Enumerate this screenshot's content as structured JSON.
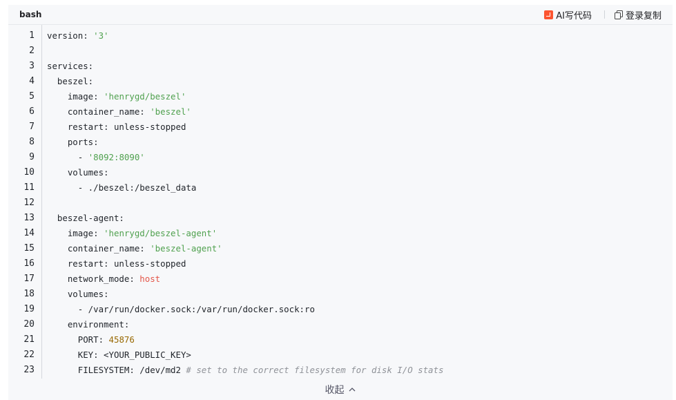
{
  "header": {
    "language": "bash",
    "ai_label": "AI写代码",
    "copy_label": "登录复制"
  },
  "footer": {
    "collapse_label": "收起"
  },
  "lines": [
    [
      {
        "t": "version: ",
        "c": ""
      },
      {
        "t": "'3'",
        "c": "string"
      }
    ],
    [
      {
        "t": "",
        "c": ""
      }
    ],
    [
      {
        "t": "services:",
        "c": ""
      }
    ],
    [
      {
        "t": "  beszel:",
        "c": ""
      }
    ],
    [
      {
        "t": "    image: ",
        "c": ""
      },
      {
        "t": "'henrygd/beszel'",
        "c": "string"
      }
    ],
    [
      {
        "t": "    container_name: ",
        "c": ""
      },
      {
        "t": "'beszel'",
        "c": "string"
      }
    ],
    [
      {
        "t": "    restart: unless-stopped",
        "c": ""
      }
    ],
    [
      {
        "t": "    ports:",
        "c": ""
      }
    ],
    [
      {
        "t": "      - ",
        "c": ""
      },
      {
        "t": "'8092:8090'",
        "c": "string"
      }
    ],
    [
      {
        "t": "    volumes:",
        "c": ""
      }
    ],
    [
      {
        "t": "      - ./beszel:/beszel_data",
        "c": ""
      }
    ],
    [
      {
        "t": "",
        "c": ""
      }
    ],
    [
      {
        "t": "  beszel-agent:",
        "c": ""
      }
    ],
    [
      {
        "t": "    image: ",
        "c": ""
      },
      {
        "t": "'henrygd/beszel-agent'",
        "c": "string"
      }
    ],
    [
      {
        "t": "    container_name: ",
        "c": ""
      },
      {
        "t": "'beszel-agent'",
        "c": "string"
      }
    ],
    [
      {
        "t": "    restart: unless-stopped",
        "c": ""
      }
    ],
    [
      {
        "t": "    network_mode: ",
        "c": ""
      },
      {
        "t": "host",
        "c": "keyword"
      }
    ],
    [
      {
        "t": "    volumes:",
        "c": ""
      }
    ],
    [
      {
        "t": "      - /var/run/docker.sock:/var/run/docker.sock:ro",
        "c": ""
      }
    ],
    [
      {
        "t": "    environment:",
        "c": ""
      }
    ],
    [
      {
        "t": "      PORT: ",
        "c": ""
      },
      {
        "t": "45876",
        "c": "number"
      }
    ],
    [
      {
        "t": "      KEY: <YOUR_PUBLIC_KEY>",
        "c": ""
      }
    ],
    [
      {
        "t": "      FILESYSTEM: /dev/md2 ",
        "c": ""
      },
      {
        "t": "# set to the correct filesystem for disk I/O stats",
        "c": "comment"
      }
    ]
  ],
  "line_numbers": [
    "1",
    "2",
    "3",
    "4",
    "5",
    "6",
    "7",
    "8",
    "9",
    "10",
    "11",
    "12",
    "13",
    "14",
    "15",
    "16",
    "17",
    "18",
    "19",
    "20",
    "21",
    "22",
    "23"
  ],
  "colors": {
    "string": "#50a14f",
    "keyword": "#e45649",
    "number": "#986801",
    "comment": "#8f9298",
    "ai_accent": "#fc5531"
  }
}
